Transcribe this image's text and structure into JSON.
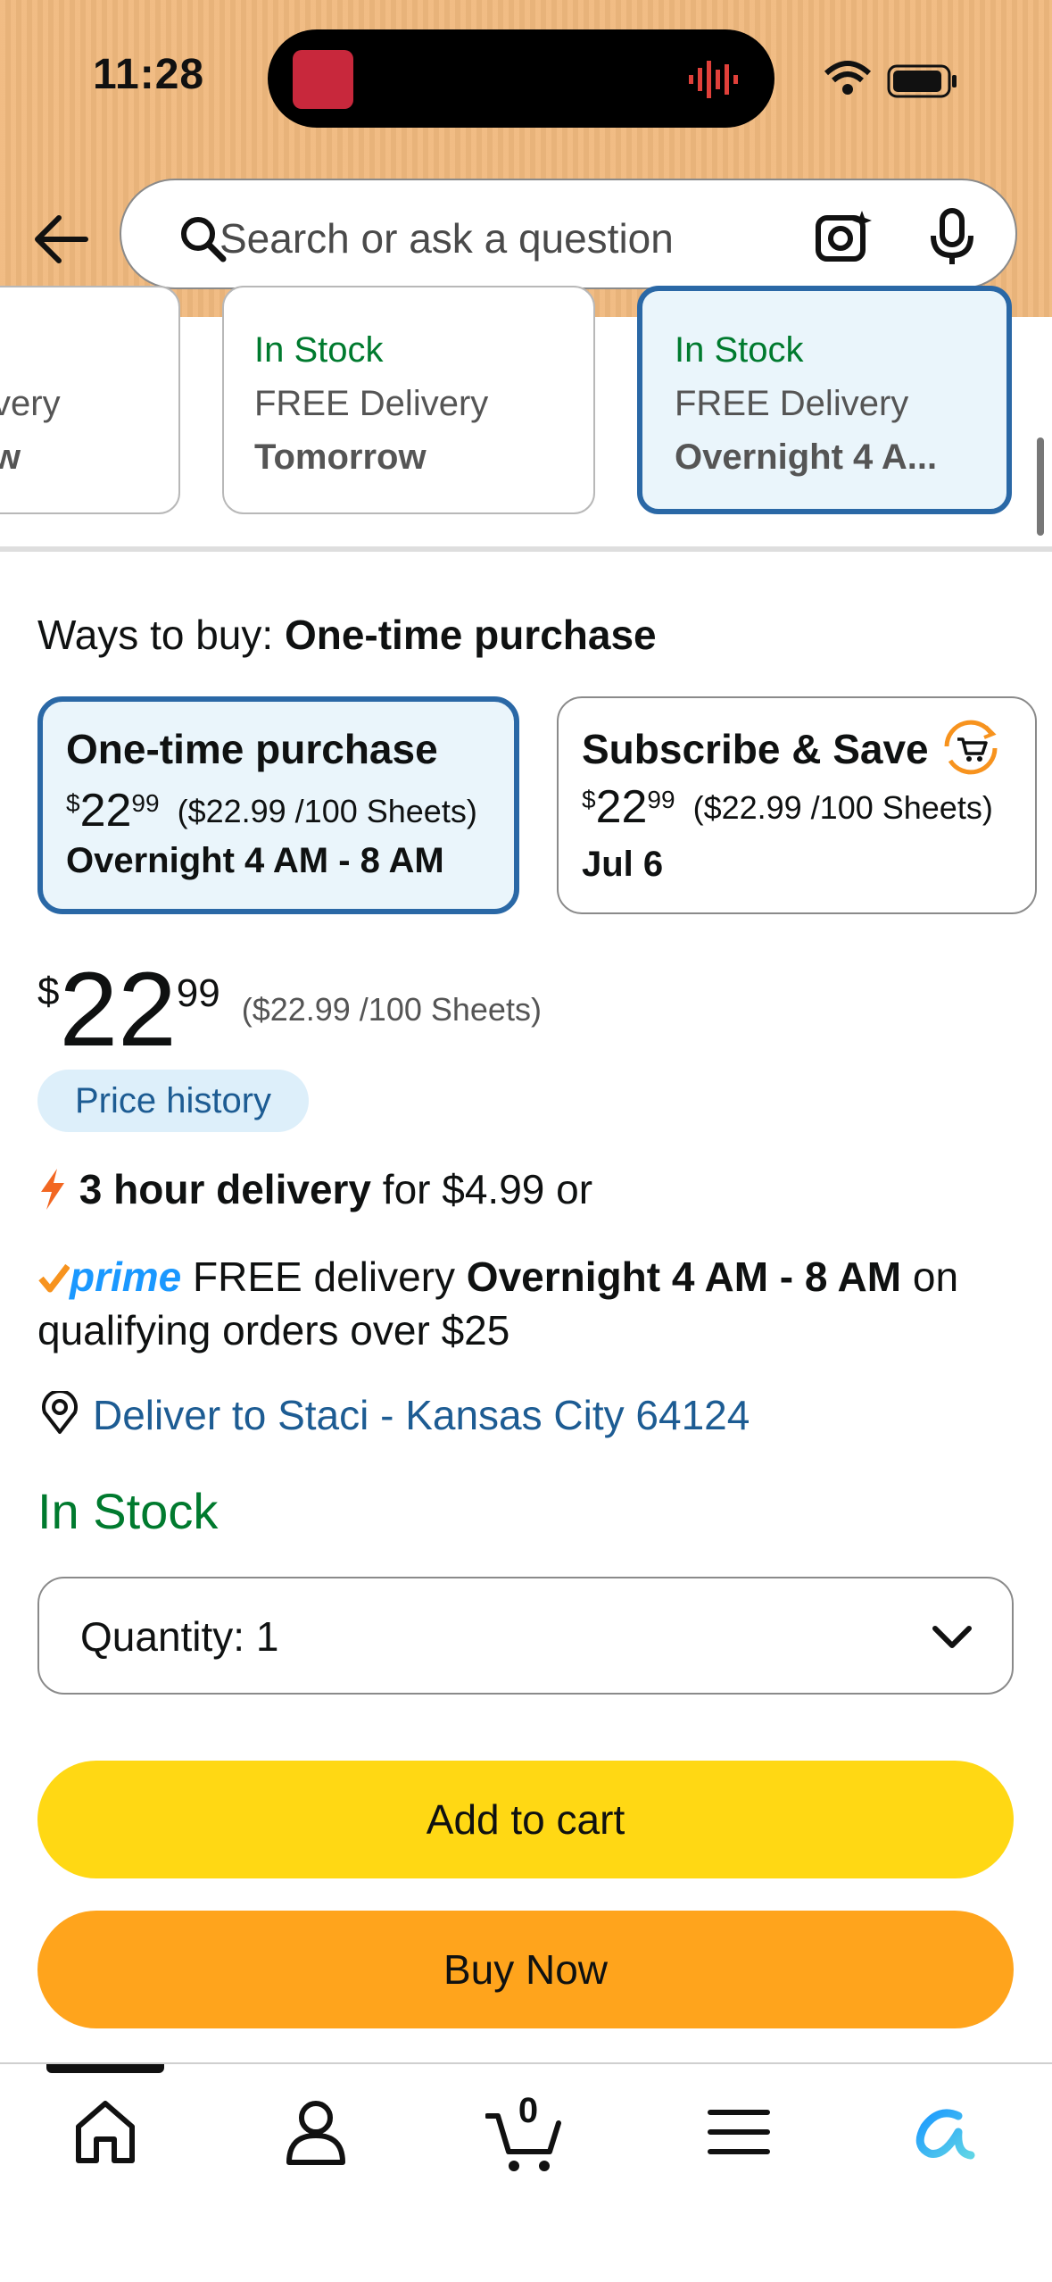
{
  "status_bar": {
    "time": "11:28"
  },
  "search": {
    "placeholder": "Search or ask a question"
  },
  "delivery_cards": [
    {
      "stock": "",
      "delivery": "very",
      "when": "w"
    },
    {
      "stock": "In Stock",
      "delivery": "FREE Delivery",
      "when": "Tomorrow"
    },
    {
      "stock": "In Stock",
      "delivery": "FREE Delivery",
      "when": "Overnight 4 A..."
    }
  ],
  "ways_to_buy": {
    "label": "Ways to buy:",
    "selected": "One-time purchase"
  },
  "options": [
    {
      "title": "One-time purchase",
      "currency": "$",
      "whole": "22",
      "cents": "99",
      "unit": "($22.99 /100 Sheets)",
      "delivery": "Overnight 4 AM - 8 AM"
    },
    {
      "title": "Subscribe & Save",
      "currency": "$",
      "whole": "22",
      "cents": "99",
      "unit": "($22.99 /100 Sheets)",
      "delivery": "Jul 6"
    }
  ],
  "price": {
    "currency": "$",
    "whole": "22",
    "cents": "99",
    "unit": "($22.99 /100 Sheets)"
  },
  "price_history": "Price history",
  "fast_delivery": {
    "bold": "3 hour delivery",
    "rest": "for $4.99 or"
  },
  "prime": {
    "logo": "prime",
    "text1": "FREE delivery",
    "bold": "Overnight 4 AM - 8 AM",
    "text2": "on qualifying orders over $25"
  },
  "deliver_to": "Deliver to Staci - Kansas City 64124",
  "stock_status": "In Stock",
  "quantity": {
    "label": "Quantity:",
    "value": "1"
  },
  "buttons": {
    "add_to_cart": "Add to cart",
    "buy_now": "Buy Now"
  },
  "nav": {
    "cart_count": "0"
  },
  "colors": {
    "header": "#f0b97e",
    "add_to_cart": "#ffd814",
    "buy_now": "#ffa41c",
    "in_stock": "#007a2e",
    "link": "#1d5c93",
    "selected_border": "#2a68a6"
  }
}
